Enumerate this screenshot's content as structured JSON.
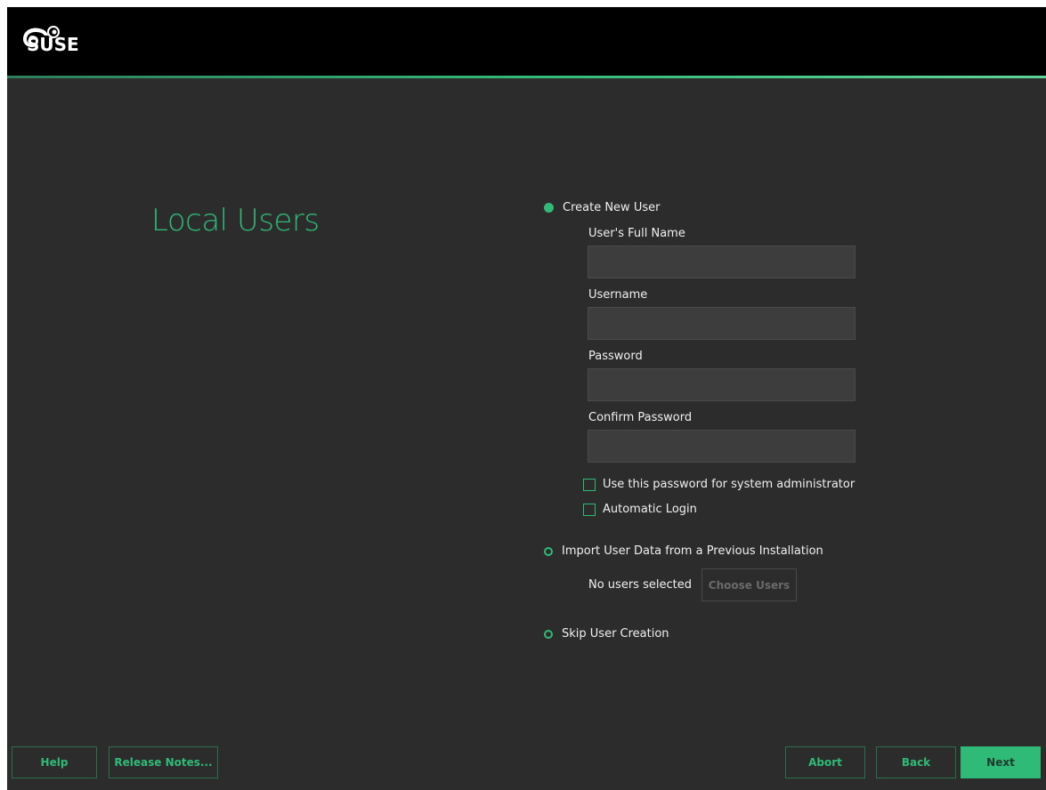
{
  "app": {
    "brand": "SUSE",
    "accent_color": "#30ba78",
    "background_color": "#2c2c2c",
    "topbar_color": "#000000"
  },
  "page": {
    "title": "Local Users"
  },
  "options": {
    "create_new_user": {
      "label": "Create New User",
      "selected": true
    },
    "import_user_data": {
      "label": "Import User Data from a Previous Installation",
      "selected": false
    },
    "skip_user_creation": {
      "label": "Skip User Creation",
      "selected": false
    }
  },
  "form": {
    "full_name": {
      "label": "User's Full Name",
      "value": ""
    },
    "username": {
      "label": "Username",
      "value": ""
    },
    "password": {
      "label": "Password",
      "value": ""
    },
    "confirm_password": {
      "label": "Confirm Password",
      "value": ""
    },
    "use_password_for_admin": {
      "label": "Use this password for system administrator",
      "checked": false
    },
    "automatic_login": {
      "label": "Automatic Login",
      "checked": false
    }
  },
  "import": {
    "status_text": "No users selected",
    "choose_users_label": "Choose Users"
  },
  "footer": {
    "help_label": "Help",
    "release_notes_label": "Release Notes...",
    "abort_label": "Abort",
    "back_label": "Back",
    "next_label": "Next"
  }
}
